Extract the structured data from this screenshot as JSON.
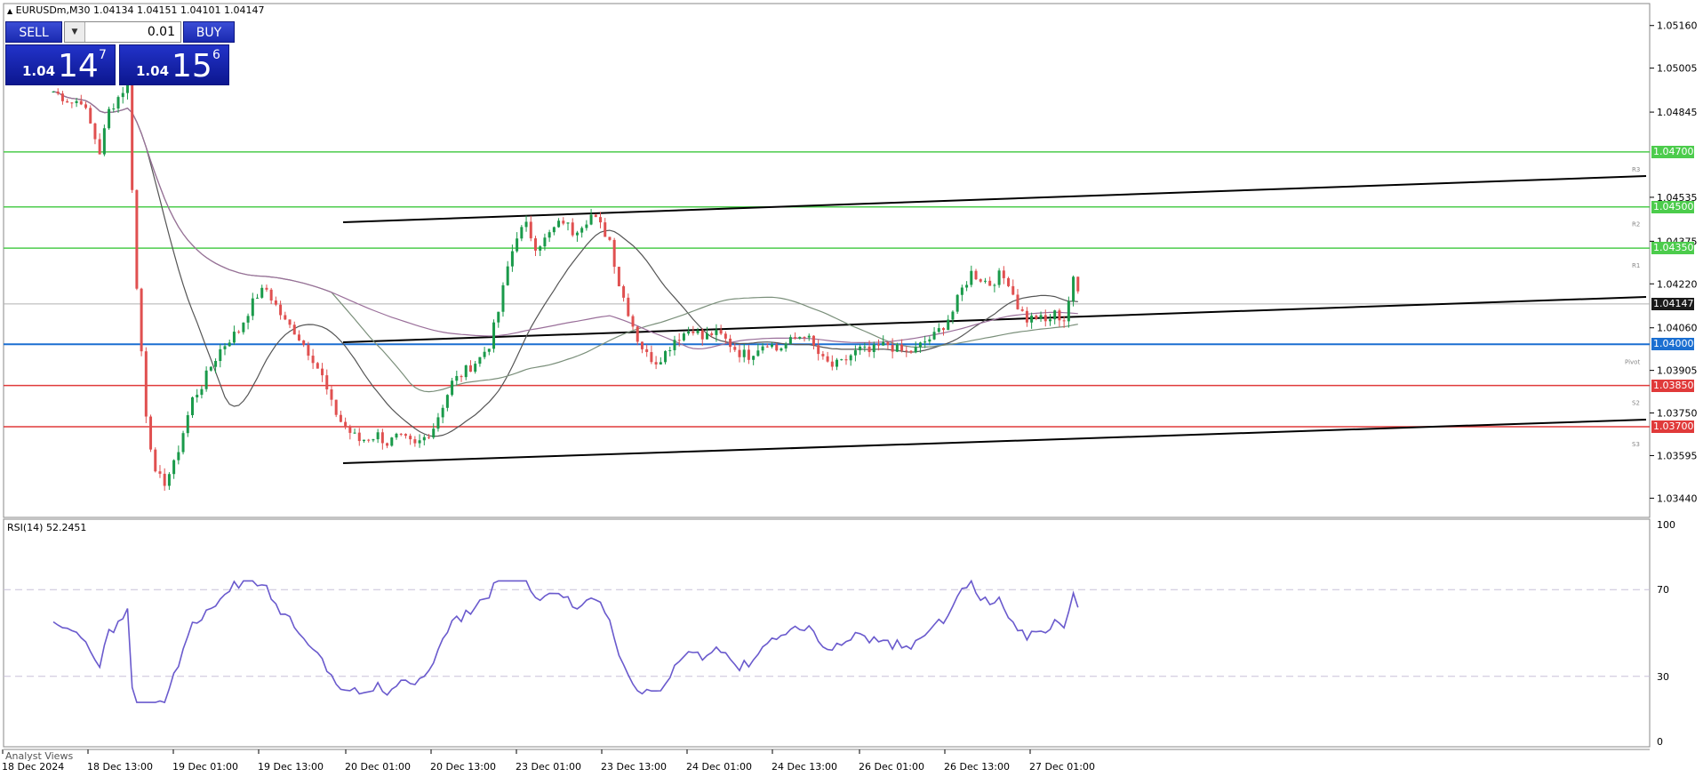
{
  "header": {
    "arrow_icon": "triangle-up-icon",
    "symbol_text": "EURUSDm,M30  1.04134 1.04151 1.04101 1.04147"
  },
  "trade_panel": {
    "sell_label": "SELL",
    "buy_label": "BUY",
    "lot_value": "0.01",
    "sell_prefix": "1.04",
    "sell_big": "14",
    "sell_sup": "7",
    "buy_prefix": "1.04",
    "buy_big": "15",
    "buy_sup": "6"
  },
  "price_axis": {
    "ticks": [
      "1.05160",
      "1.05005",
      "1.04845",
      "1.04535",
      "1.04375",
      "1.04220",
      "1.04060",
      "1.03905",
      "1.03750",
      "1.03595",
      "1.03440"
    ]
  },
  "levels": [
    {
      "label": "1.04700",
      "tag": "R3",
      "value": 1.047,
      "color": "#4ccc4c"
    },
    {
      "label": "1.04500",
      "tag": "R2",
      "value": 1.045,
      "color": "#4ccc4c"
    },
    {
      "label": "1.04350",
      "tag": "R1",
      "value": 1.0435,
      "color": "#4ccc4c"
    },
    {
      "label": "1.04000",
      "tag": "Pivot",
      "value": 1.04,
      "color": "#1b6fd1"
    },
    {
      "label": "1.03850",
      "tag": "S2",
      "value": 1.0385,
      "color": "#e03a3a"
    },
    {
      "label": "1.03700",
      "tag": "S3",
      "value": 1.037,
      "color": "#e03a3a"
    }
  ],
  "current_price": {
    "label": "1.04147",
    "value": 1.04147,
    "color": "#1a1a1a"
  },
  "rsi": {
    "title": "RSI(14) 52.2451",
    "levels": [
      "100",
      "70",
      "30",
      "0"
    ]
  },
  "time_axis": {
    "labels": [
      "18 Dec 2024",
      "18 Dec 13:00",
      "19 Dec 01:00",
      "19 Dec 13:00",
      "20 Dec 01:00",
      "20 Dec 13:00",
      "23 Dec 01:00",
      "23 Dec 13:00",
      "24 Dec 01:00",
      "24 Dec 13:00",
      "26 Dec 01:00",
      "26 Dec 13:00",
      "27 Dec 01:00"
    ]
  },
  "bottom_tab": "Analyst Views",
  "colors": {
    "bull": "#1a9a4a",
    "bear": "#e05050",
    "rsi_line": "#6a5acd",
    "ma_slow": "#9a6f9a",
    "ma_fast": "#555555"
  },
  "chart_data": {
    "type": "candlestick",
    "title": "EURUSDm,M30",
    "ylim": [
      1.0337,
      1.0524
    ],
    "close_path": [
      1.0492,
      1.049,
      1.0488,
      1.0489,
      1.048,
      1.047,
      1.0485,
      1.049,
      1.0495,
      1.042,
      1.0375,
      1.0352,
      1.035,
      1.0356,
      1.0368,
      1.038,
      1.0385,
      1.0392,
      1.0398,
      1.0402,
      1.0405,
      1.0412,
      1.0418,
      1.042,
      1.0414,
      1.0408,
      1.0405,
      1.04,
      1.0395,
      1.0388,
      1.0378,
      1.0372,
      1.0368,
      1.0365,
      1.0366,
      1.0367,
      1.0364,
      1.0366,
      1.0365,
      1.0363,
      1.0366,
      1.037,
      1.0378,
      1.0386,
      1.0389,
      1.0392,
      1.0395,
      1.04,
      1.0412,
      1.0428,
      1.044,
      1.0443,
      1.0436,
      1.0438,
      1.0442,
      1.0445,
      1.0441,
      1.0444,
      1.0447,
      1.0443,
      1.0438,
      1.0422,
      1.0412,
      1.0402,
      1.0396,
      1.0394,
      1.0397,
      1.0402,
      1.0404,
      1.0406,
      1.0402,
      1.0404,
      1.0403,
      1.04,
      1.0397,
      1.0396,
      1.0399,
      1.0401,
      1.0398,
      1.04,
      1.0402,
      1.0404,
      1.0399,
      1.0394,
      1.0392,
      1.0393,
      1.0396,
      1.0398,
      1.0397,
      1.0399,
      1.04,
      1.0398,
      1.0397,
      1.0398,
      1.0401,
      1.0403,
      1.0407,
      1.0412,
      1.042,
      1.0426,
      1.0424,
      1.0422,
      1.0425,
      1.0423,
      1.0414,
      1.0409,
      1.041,
      1.0408,
      1.0411,
      1.0409,
      1.0423,
      1.0415
    ]
  }
}
